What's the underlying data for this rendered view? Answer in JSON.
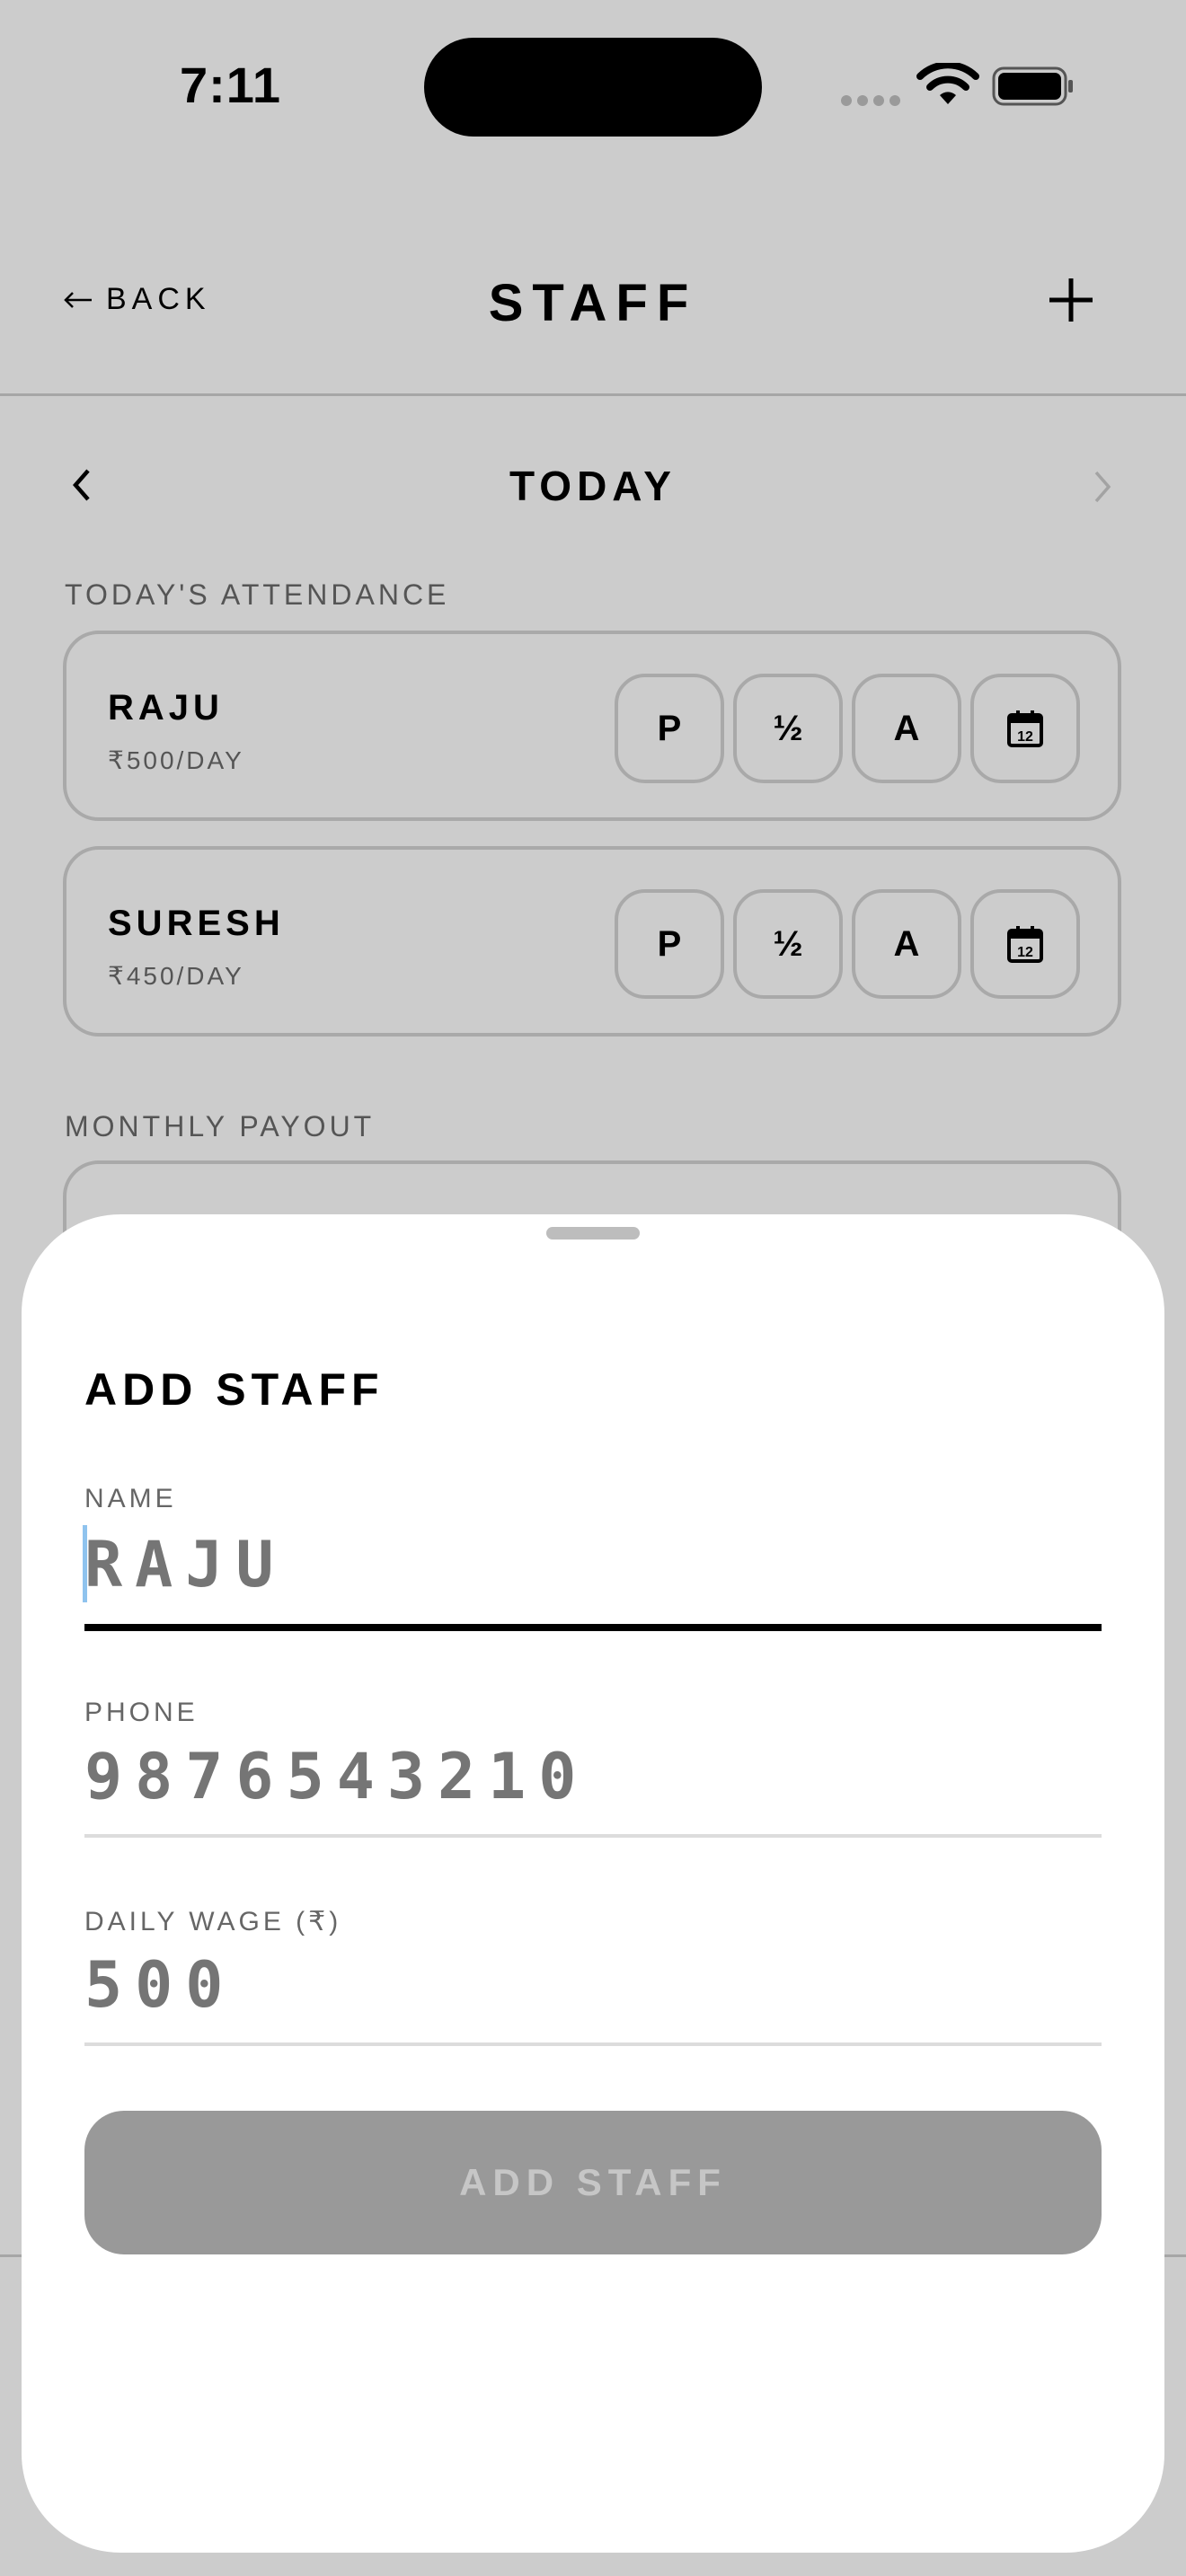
{
  "status_bar": {
    "time": "7:11"
  },
  "header": {
    "back_label": "BACK",
    "title": "STAFF"
  },
  "day_nav": {
    "label": "TODAY"
  },
  "attendance": {
    "section_label": "TODAY'S ATTENDANCE",
    "staff": [
      {
        "name": "RAJU",
        "wage": "₹500/DAY"
      },
      {
        "name": "SURESH",
        "wage": "₹450/DAY"
      }
    ],
    "buttons": {
      "present": "P",
      "half": "½",
      "absent": "A",
      "calendar_day": "12"
    }
  },
  "payout": {
    "section_label": "MONTHLY PAYOUT"
  },
  "sheet": {
    "title": "ADD STAFF",
    "fields": {
      "name": {
        "label": "NAME",
        "placeholder": "RAJU",
        "value": ""
      },
      "phone": {
        "label": "PHONE",
        "placeholder": "9876543210",
        "value": ""
      },
      "wage": {
        "label": "DAILY WAGE (₹)",
        "placeholder": "500",
        "value": ""
      }
    },
    "submit_label": "ADD STAFF",
    "colors": {
      "submit_disabled_bg": "#999999",
      "focus_underline": "#000000",
      "caret": "#8fc3ee"
    }
  }
}
